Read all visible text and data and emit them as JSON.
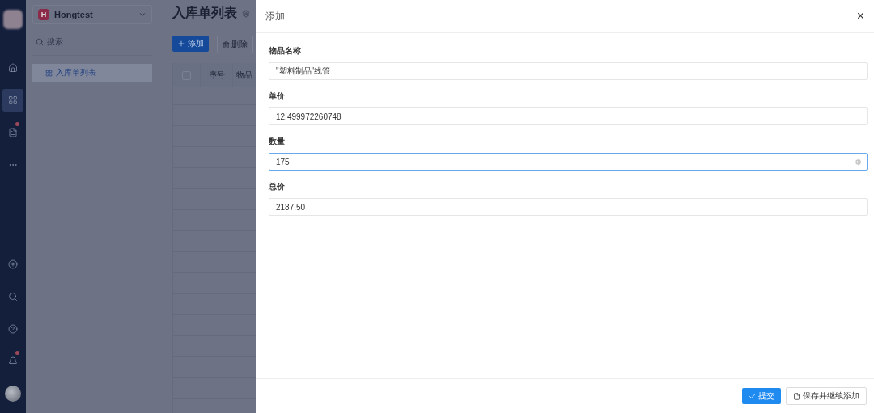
{
  "rail": {
    "items": [
      {
        "kind": "home",
        "selected": false,
        "badge": false
      },
      {
        "kind": "apps",
        "selected": true,
        "badge": false
      },
      {
        "kind": "doc",
        "selected": false,
        "badge": true
      },
      {
        "kind": "more",
        "selected": false,
        "badge": false
      }
    ],
    "bottom": [
      {
        "kind": "add",
        "badge": false
      },
      {
        "kind": "search",
        "badge": false
      },
      {
        "kind": "help",
        "badge": false
      },
      {
        "kind": "bell",
        "badge": true
      }
    ]
  },
  "sidebar": {
    "app_initial": "H",
    "app_name": "Hongtest",
    "search_placeholder": "搜索",
    "items": [
      {
        "label": "入库单列表",
        "selected": true
      }
    ]
  },
  "main": {
    "title": "入库单列表",
    "add_button": "添加",
    "delete_button": "删除",
    "select_all_checked": false,
    "columns": [
      "序号",
      "物品"
    ]
  },
  "drawer": {
    "title": "添加",
    "close": "×",
    "fields": [
      {
        "label": "物品名称",
        "value": "\"塑料制品\"线管",
        "focused": false
      },
      {
        "label": "单价",
        "value": "12.499972260748",
        "focused": false
      },
      {
        "label": "数量",
        "value": "175",
        "focused": true
      },
      {
        "label": "总价",
        "value": "2187.50",
        "focused": false
      }
    ],
    "submit": "提交",
    "save_continue": "保存并继续添加"
  }
}
